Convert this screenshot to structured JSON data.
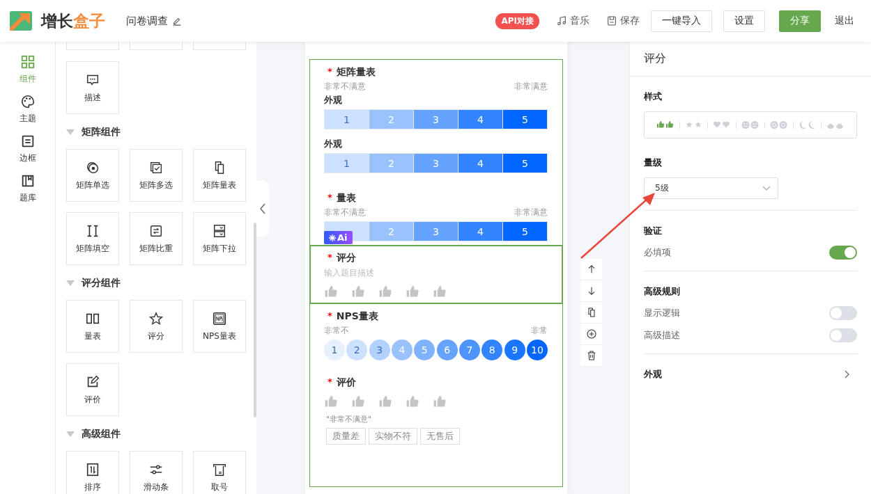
{
  "header": {
    "brand_main": "增长",
    "brand_accent": "盒子",
    "doc_title": "问卷调查",
    "api_badge": "API对接",
    "links": [
      {
        "kind": "music",
        "label": "音乐"
      },
      {
        "kind": "save",
        "label": "保存"
      }
    ],
    "buttons": [
      {
        "kind": "outline",
        "label": "一键导入"
      },
      {
        "kind": "outline",
        "label": "设置"
      },
      {
        "kind": "primary",
        "label": "分享"
      },
      {
        "kind": "plain",
        "label": "退出"
      }
    ]
  },
  "rail": [
    {
      "kind": "grid",
      "label": "组件",
      "selected": true
    },
    {
      "kind": "palette",
      "label": "主题",
      "selected": false
    },
    {
      "kind": "frame",
      "label": "边框",
      "selected": false
    },
    {
      "kind": "book",
      "label": "题库",
      "selected": false
    }
  ],
  "component_groups": [
    {
      "items": [
        {
          "kind": "partial"
        },
        {
          "kind": "partial"
        },
        {
          "kind": "partial"
        },
        {
          "kind": "comment",
          "label": "描述"
        }
      ]
    },
    {
      "title": "矩阵组件",
      "expanded": true,
      "items": [
        {
          "kind": "radio",
          "label": "矩阵单选"
        },
        {
          "kind": "check",
          "label": "矩阵多选"
        },
        {
          "kind": "copy",
          "label": "矩阵量表"
        },
        {
          "kind": "fill",
          "label": "矩阵填空"
        },
        {
          "kind": "weight",
          "label": "矩阵比重"
        },
        {
          "kind": "dropdown",
          "label": "矩阵下拉"
        }
      ]
    },
    {
      "title": "评分组件",
      "expanded": true,
      "items": [
        {
          "kind": "bars",
          "label": "量表"
        },
        {
          "kind": "star",
          "label": "评分"
        },
        {
          "kind": "nps",
          "label": "NPS量表"
        },
        {
          "kind": "edit",
          "label": "评价"
        }
      ]
    },
    {
      "title": "高级组件",
      "expanded": true,
      "items": [
        {
          "kind": "sort",
          "label": "排序"
        },
        {
          "kind": "slider",
          "label": "滑动条"
        },
        {
          "kind": "ticket",
          "label": "取号"
        }
      ]
    }
  ],
  "questions": [
    {
      "kind": "matrix",
      "title": "矩阵量表",
      "required_mark": "*",
      "selected": false,
      "low_label": "非常不满意",
      "high_label": "非常满意",
      "rows": [
        {
          "label": "外观",
          "options": [
            "1",
            "2",
            "3",
            "4",
            "5"
          ]
        },
        {
          "label": "外观",
          "options": [
            "1",
            "2",
            "3",
            "4",
            "5"
          ]
        }
      ]
    },
    {
      "kind": "scale",
      "title": "量表",
      "required_mark": "*",
      "selected": false,
      "low_label": "非常不满意",
      "high_label": "非常满意",
      "ai_badge": "Ai",
      "options": [
        "2",
        "3",
        "4",
        "5"
      ]
    },
    {
      "kind": "rating",
      "title": "评分",
      "required_mark": "*",
      "selected": true,
      "placeholder": "输入题目描述",
      "stars": 0
    },
    {
      "kind": "nps",
      "title": "NPS量表",
      "required_mark": "*",
      "selected": false,
      "low_label": "非常不",
      "high_label": "非常",
      "options": [
        "1",
        "2",
        "3",
        "4",
        "5",
        "6",
        "7",
        "8",
        "9",
        "10"
      ]
    },
    {
      "kind": "review",
      "title": "评价",
      "required_mark": "*",
      "selected": false,
      "stars": 0,
      "caption": "\"非常不满意\"",
      "tags": [
        "质量差",
        "实物不符",
        "无售后"
      ]
    }
  ],
  "question_toolbar": [
    {
      "kind": "up"
    },
    {
      "kind": "down"
    },
    {
      "kind": "copy"
    },
    {
      "kind": "add"
    },
    {
      "kind": "delete"
    }
  ],
  "properties": {
    "title": "评分",
    "style_label": "样式",
    "styles": [
      {
        "kind": "thumb",
        "selected": true
      },
      {
        "kind": "star",
        "selected": false
      },
      {
        "kind": "heart",
        "selected": false
      },
      {
        "kind": "face",
        "selected": false
      },
      {
        "kind": "dot",
        "selected": false
      },
      {
        "kind": "moon",
        "selected": false
      },
      {
        "kind": "flower",
        "selected": false
      }
    ],
    "level_label": "量级",
    "level_value": "5级",
    "sections": [
      {
        "title": "验证",
        "toggles": [
          {
            "label": "必填项",
            "on": true
          }
        ]
      },
      {
        "title": "高级规则",
        "toggles": [
          {
            "label": "显示逻辑",
            "on": false
          },
          {
            "label": "高级描述",
            "on": false
          }
        ]
      }
    ],
    "appearance": "外观"
  }
}
